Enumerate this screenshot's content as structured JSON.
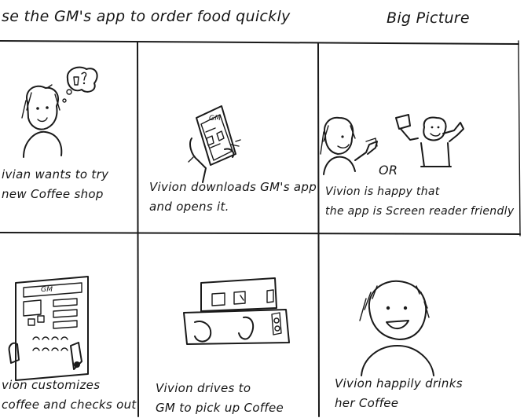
{
  "header": {
    "title": "se the GM's app to order food quickly",
    "big_picture": "Big Picture"
  },
  "panels": [
    {
      "caption": [
        "ivian wants to try",
        "new Coffee shop"
      ],
      "icon": "person-thinking-coffee-icon"
    },
    {
      "caption": [
        "Vivion downloads GM's app",
        "and opens it."
      ],
      "icon": "phone-app-download-icon"
    },
    {
      "caption": [
        "Vivion is happy that",
        "the app is Screen reader friendly"
      ],
      "or_label": "OR",
      "icon": "happy-person-phone-icon"
    },
    {
      "caption": [
        "vion customizes",
        "coffee and checks out"
      ],
      "icon": "app-screen-customize-icon"
    },
    {
      "caption": [
        "Vivion drives to",
        "GM to pick up Coffee"
      ],
      "icon": "car-pickup-icon"
    },
    {
      "caption": [
        "Vivion happily drinks",
        "her Coffee"
      ],
      "icon": "smiling-person-icon"
    }
  ],
  "phone_label": "GM",
  "app_label": "GM"
}
